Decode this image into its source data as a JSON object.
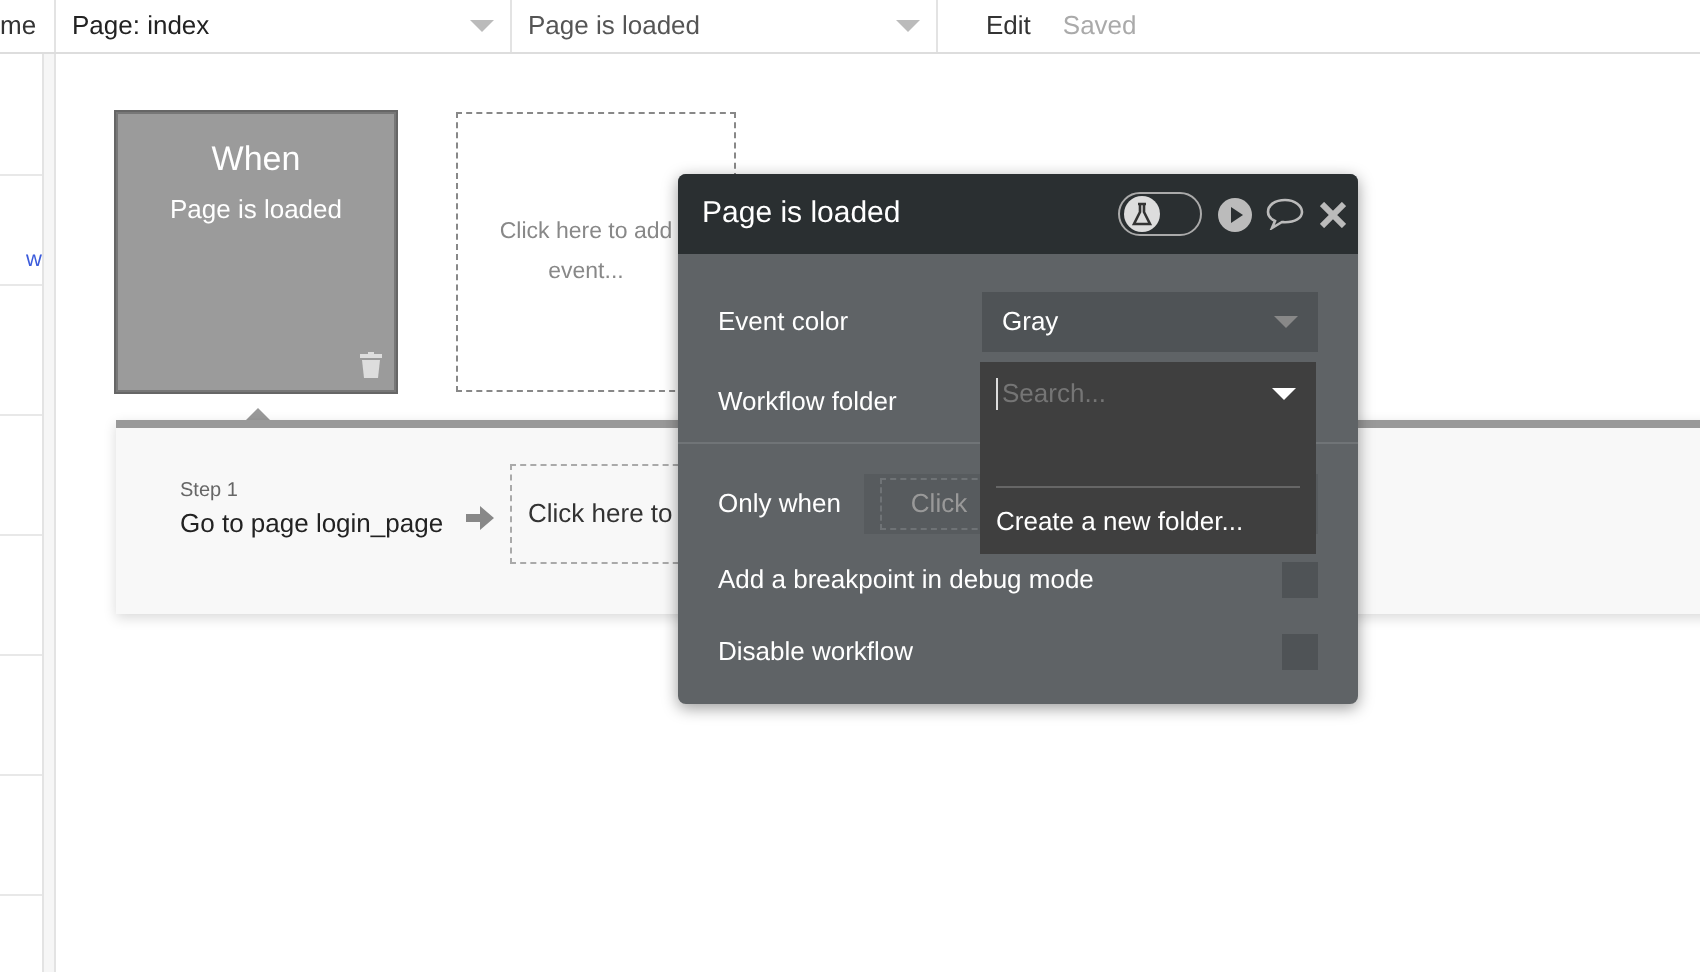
{
  "topbar": {
    "cut_label": "me",
    "page_dropdown": "Page: index",
    "event_dropdown": "Page is loaded",
    "edit": "Edit",
    "save_status": "Saved"
  },
  "sidebar": {
    "cut_link": "w"
  },
  "event_card": {
    "title": "When",
    "subtitle": "Page is loaded",
    "color": "#9b9b9b",
    "selected": true
  },
  "add_event": {
    "lines": [
      "Click here to add",
      "event..."
    ]
  },
  "steps": [
    {
      "label": "Step 1",
      "action": "Go to page login_page"
    }
  ],
  "add_action": "Click here to",
  "popup": {
    "title": "Page is loaded",
    "debug_toggle_on": false,
    "event_color": {
      "label": "Event color",
      "value": "Gray"
    },
    "workflow_folder": {
      "label": "Workflow folder",
      "placeholder": "Search...",
      "expanded": true,
      "options": [
        "Create a new folder..."
      ]
    },
    "only_when": {
      "label": "Only when",
      "placeholder": "Click"
    },
    "checkboxes": [
      {
        "label": "Add a breakpoint in debug mode",
        "checked": false
      },
      {
        "label": "Disable workflow",
        "checked": false
      }
    ]
  }
}
